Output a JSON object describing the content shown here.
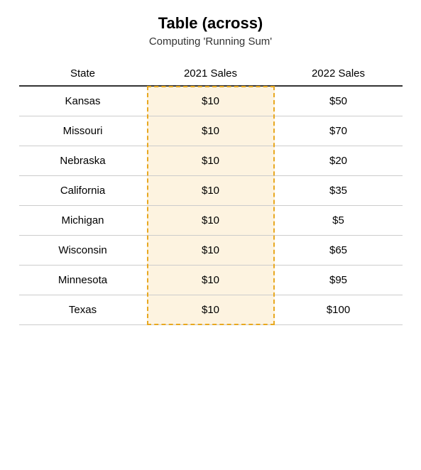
{
  "title": "Table (across)",
  "subtitle": "Computing 'Running Sum'",
  "columns": {
    "col1": "State",
    "col2": "2021 Sales",
    "col3": "2022 Sales"
  },
  "rows": [
    {
      "state": "Kansas",
      "sales2021": "$10",
      "sales2022": "$50"
    },
    {
      "state": "Missouri",
      "sales2021": "$10",
      "sales2022": "$70"
    },
    {
      "state": "Nebraska",
      "sales2021": "$10",
      "sales2022": "$20"
    },
    {
      "state": "California",
      "sales2021": "$10",
      "sales2022": "$35"
    },
    {
      "state": "Michigan",
      "sales2021": "$10",
      "sales2022": "$5"
    },
    {
      "state": "Wisconsin",
      "sales2021": "$10",
      "sales2022": "$65"
    },
    {
      "state": "Minnesota",
      "sales2021": "$10",
      "sales2022": "$95"
    },
    {
      "state": "Texas",
      "sales2021": "$10",
      "sales2022": "$100"
    }
  ]
}
